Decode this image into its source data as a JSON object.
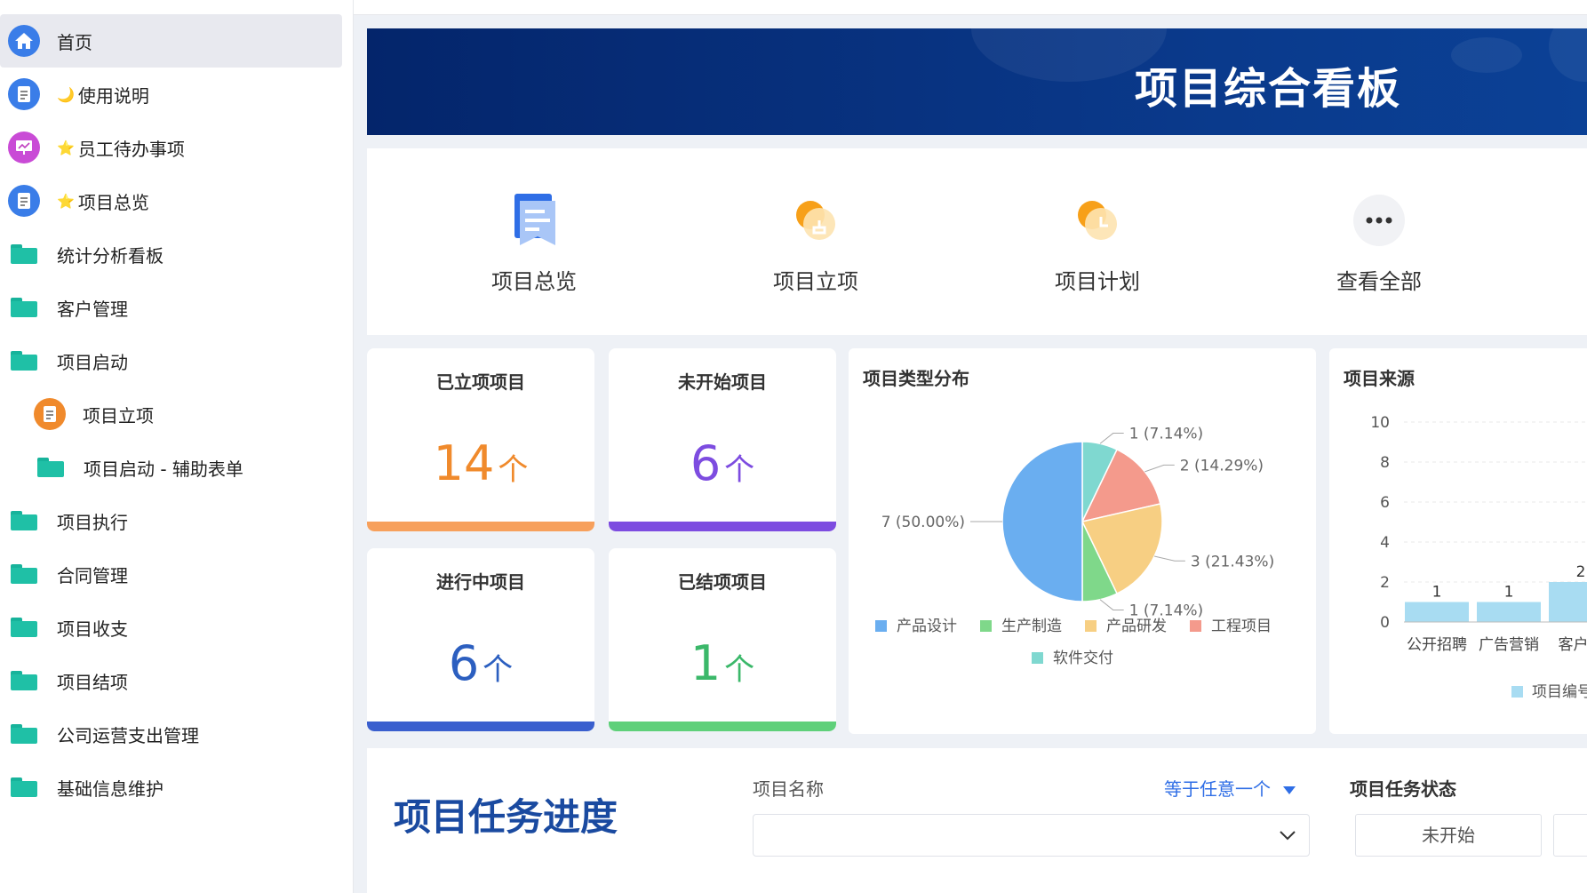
{
  "sidebar": {
    "items": [
      {
        "label": "首页",
        "icon": "home-icon",
        "active": true
      },
      {
        "label": "使用说明",
        "prefix": "🌙",
        "icon": "document-icon"
      },
      {
        "label": "员工待办事项",
        "prefix": "⭐",
        "icon": "presentation-icon"
      },
      {
        "label": "项目总览",
        "prefix": "⭐",
        "icon": "document-icon"
      },
      {
        "label": "统计分析看板",
        "icon": "folder-icon"
      },
      {
        "label": "客户管理",
        "icon": "folder-icon"
      },
      {
        "label": "项目启动",
        "icon": "folder-open-icon"
      },
      {
        "label": "项目立项",
        "icon": "document-icon"
      },
      {
        "label": "项目启动 - 辅助表单",
        "icon": "folder-icon"
      },
      {
        "label": "项目执行",
        "icon": "folder-icon"
      },
      {
        "label": "合同管理",
        "icon": "folder-icon"
      },
      {
        "label": "项目收支",
        "icon": "folder-icon"
      },
      {
        "label": "项目结项",
        "icon": "folder-icon"
      },
      {
        "label": "公司运营支出管理",
        "icon": "folder-icon"
      },
      {
        "label": "基础信息维护",
        "icon": "folder-icon"
      }
    ]
  },
  "banner": {
    "title": "项目综合看板"
  },
  "quick_links": [
    {
      "label": "项目总览",
      "icon": "overview-icon"
    },
    {
      "label": "项目立项",
      "icon": "project-setup-icon"
    },
    {
      "label": "项目计划",
      "icon": "project-plan-icon"
    },
    {
      "label": "查看全部",
      "icon": "more-icon"
    }
  ],
  "stats": [
    {
      "title": "已立项项目",
      "value": "14",
      "unit": "个",
      "color": "#f08a2c",
      "bar": "#f7a05c"
    },
    {
      "title": "未开始项目",
      "value": "6",
      "unit": "个",
      "color": "#7d4ce0",
      "bar": "#7d4ce0"
    },
    {
      "title": "进行中项目",
      "value": "6",
      "unit": "个",
      "color": "#2c5fc0",
      "bar": "#3a5fce"
    },
    {
      "title": "已结项项目",
      "value": "1",
      "unit": "个",
      "color": "#3bb86a",
      "bar": "#5fd07a"
    }
  ],
  "type_panel": {
    "title": "项目类型分布"
  },
  "source_panel": {
    "title": "项目来源"
  },
  "chart_data": [
    {
      "type": "pie",
      "title": "项目类型分布",
      "categories": [
        "产品设计",
        "生产制造",
        "产品研发",
        "工程项目",
        "软件交付"
      ],
      "values": [
        7,
        1,
        3,
        2,
        1
      ],
      "labels": [
        "7 (50.00%)",
        "1 (7.14%)",
        "3 (21.43%)",
        "2 (14.29%)",
        "1 (7.14%)"
      ],
      "colors": [
        "#6aaef0",
        "#7fd88a",
        "#f7cf83",
        "#f49a8c",
        "#7fd8d0"
      ],
      "legend_position": "bottom"
    },
    {
      "type": "bar",
      "title": "项目来源",
      "categories": [
        "公开招聘",
        "广告营销",
        "客户介"
      ],
      "values": [
        1,
        1,
        2
      ],
      "value_labels": [
        "1",
        "1",
        "2"
      ],
      "legend": "项目编号",
      "yticks": [
        "0",
        "2",
        "4",
        "6",
        "8",
        "10"
      ],
      "ylim": [
        0,
        10
      ],
      "grid": true,
      "color": "#a8dcf2"
    }
  ],
  "task_section": {
    "title": "项目任务进度",
    "name_filter_label": "项目名称",
    "name_filter_op": "等于任意一个",
    "status_filter_label": "项目任务状态",
    "status_option": "未开始"
  }
}
